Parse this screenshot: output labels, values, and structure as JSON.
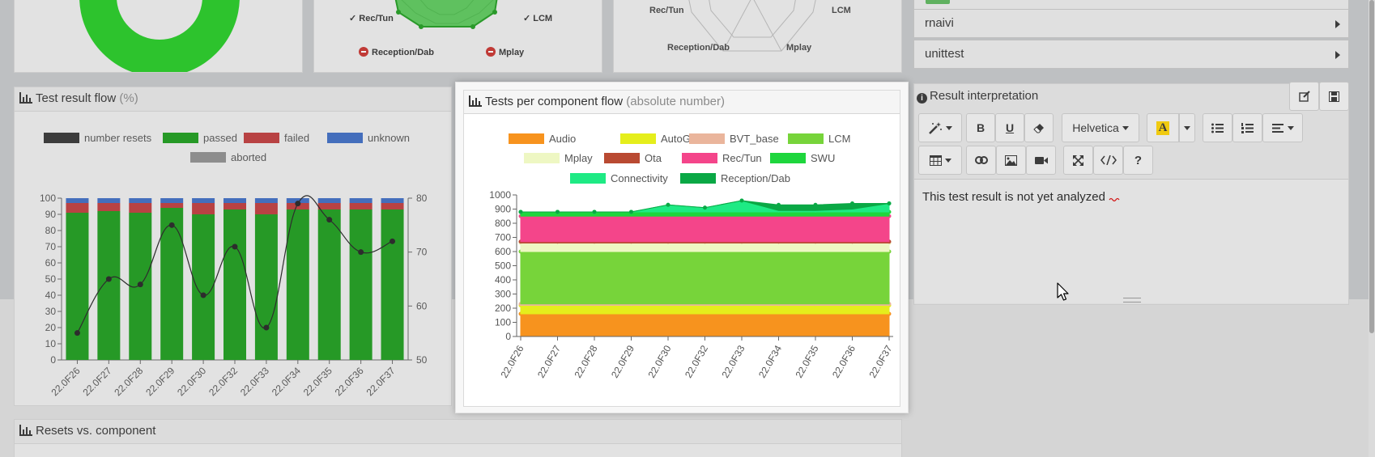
{
  "radar_top": {
    "left_labels": {
      "rec_tun": "✓ Rec/Tun",
      "lcm": "✓ LCM",
      "reception_dab": "Reception/Dab",
      "mplay": "Mplay"
    },
    "right_labels": {
      "rec_tun": "Rec/Tun",
      "lcm": "LCM",
      "reception_dab": "Reception/Dab",
      "mplay": "Mplay"
    }
  },
  "accordion": {
    "items": [
      "rnaivi",
      "unittest"
    ]
  },
  "test_result_flow": {
    "title": "Test result flow",
    "title_suffix": "(%)",
    "legend": [
      {
        "name": "number resets",
        "color": "#333333"
      },
      {
        "name": "passed",
        "color": "#1a9c1a"
      },
      {
        "name": "failed",
        "color": "#c0393b"
      },
      {
        "name": "unknown",
        "color": "#3c6cc4"
      },
      {
        "name": "aborted",
        "color": "#8f8f8f"
      }
    ]
  },
  "tests_per_component": {
    "title": "Tests per component flow",
    "title_suffix": "(absolute number)",
    "legend": [
      {
        "name": "Audio",
        "color": "#f7931e"
      },
      {
        "name": "AutoGW",
        "color": "#e5ee1c"
      },
      {
        "name": "BVT_base",
        "color": "#eab59c"
      },
      {
        "name": "LCM",
        "color": "#77d43a"
      },
      {
        "name": "Mplay",
        "color": "#eef7c3"
      },
      {
        "name": "Ota",
        "color": "#b94a32"
      },
      {
        "name": "Rec/Tun",
        "color": "#f4458a"
      },
      {
        "name": "SWU",
        "color": "#1ed63d"
      },
      {
        "name": "Connectivity",
        "color": "#1eea84"
      },
      {
        "name": "Reception/Dab",
        "color": "#0aa845"
      }
    ]
  },
  "resets_vs_component": {
    "title": "Resets vs. component"
  },
  "result_interpretation": {
    "title": "Result interpretation",
    "font_name": "Helvetica",
    "text": "This test result is not yet analyzed"
  },
  "chart_data": [
    {
      "type": "bar",
      "title": "Test result flow (%)",
      "categories": [
        "22.0F26",
        "22.0F27",
        "22.0F28",
        "22.0F29",
        "22.0F30",
        "22.0F32",
        "22.0F33",
        "22.0F34",
        "22.0F35",
        "22.0F36",
        "22.0F37"
      ],
      "ylim": [
        0,
        100
      ],
      "yticks": [
        0,
        10,
        20,
        30,
        40,
        50,
        60,
        70,
        80,
        90,
        100
      ],
      "y2lim": [
        50,
        80
      ],
      "y2ticks": [
        50,
        60,
        70,
        80
      ],
      "stacked": true,
      "series": [
        {
          "name": "passed",
          "values": [
            91,
            92,
            91,
            94,
            90,
            93,
            90,
            93,
            93,
            93,
            93
          ]
        },
        {
          "name": "failed",
          "values": [
            6,
            5,
            6,
            3,
            7,
            4,
            7,
            4,
            4,
            4,
            4
          ]
        },
        {
          "name": "unknown",
          "values": [
            3,
            3,
            3,
            3,
            3,
            3,
            3,
            3,
            3,
            3,
            3
          ]
        },
        {
          "name": "aborted",
          "values": [
            0,
            0,
            0,
            0,
            0,
            0,
            0,
            0,
            0,
            0,
            0
          ]
        }
      ],
      "line_series": {
        "name": "number resets",
        "axis": "right",
        "values": [
          55,
          65,
          64,
          75,
          62,
          71,
          56,
          79,
          76,
          70,
          72
        ]
      }
    },
    {
      "type": "area",
      "title": "Tests per component flow (absolute number)",
      "categories": [
        "22.0F26",
        "22.0F27",
        "22.0F28",
        "22.0F29",
        "22.0F30",
        "22.0F32",
        "22.0F33",
        "22.0F34",
        "22.0F35",
        "22.0F36",
        "22.0F37"
      ],
      "ylim": [
        0,
        1000
      ],
      "yticks": [
        0,
        100,
        200,
        300,
        400,
        500,
        600,
        700,
        800,
        900,
        1000
      ],
      "stacked": true,
      "series": [
        {
          "name": "Audio",
          "values": [
            160,
            160,
            160,
            160,
            160,
            160,
            160,
            160,
            160,
            160,
            160
          ]
        },
        {
          "name": "AutoGW",
          "values": [
            60,
            60,
            60,
            60,
            60,
            60,
            60,
            60,
            60,
            60,
            60
          ]
        },
        {
          "name": "BVT_base",
          "values": [
            10,
            10,
            10,
            10,
            10,
            10,
            10,
            10,
            10,
            10,
            10
          ]
        },
        {
          "name": "LCM",
          "values": [
            370,
            370,
            370,
            370,
            370,
            370,
            370,
            370,
            370,
            370,
            370
          ]
        },
        {
          "name": "Mplay",
          "values": [
            60,
            60,
            60,
            60,
            60,
            60,
            60,
            60,
            60,
            60,
            60
          ]
        },
        {
          "name": "Ota",
          "values": [
            10,
            10,
            10,
            10,
            10,
            10,
            10,
            10,
            10,
            10,
            10
          ]
        },
        {
          "name": "Rec/Tun",
          "values": [
            180,
            180,
            180,
            180,
            180,
            180,
            180,
            180,
            180,
            180,
            180
          ]
        },
        {
          "name": "SWU",
          "values": [
            30,
            30,
            30,
            30,
            30,
            30,
            30,
            30,
            30,
            30,
            30
          ]
        },
        {
          "name": "Connectivity",
          "values": [
            0,
            0,
            0,
            0,
            50,
            30,
            80,
            10,
            10,
            20,
            60
          ]
        },
        {
          "name": "Reception/Dab",
          "values": [
            0,
            0,
            0,
            0,
            0,
            0,
            0,
            40,
            40,
            40,
            0
          ]
        }
      ]
    }
  ]
}
